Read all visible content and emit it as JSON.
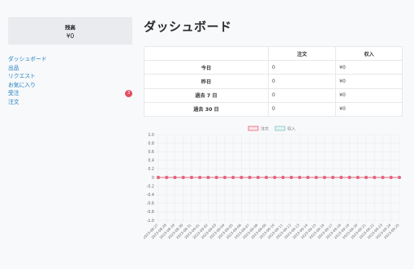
{
  "sidebar": {
    "balance": {
      "label": "残高",
      "value": "¥0"
    },
    "items": [
      {
        "label": "ダッシュボード"
      },
      {
        "label": "出品"
      },
      {
        "label": "リクエスト"
      },
      {
        "label": "お気に入り"
      },
      {
        "label": "受注",
        "badge": "3"
      },
      {
        "label": "注文"
      }
    ]
  },
  "main": {
    "title": "ダッシュボード",
    "table": {
      "headers": [
        "",
        "注文",
        "収入"
      ],
      "rows": [
        {
          "period": "今日",
          "orders": "0",
          "income": "¥0"
        },
        {
          "period": "昨日",
          "orders": "0",
          "income": "¥0"
        },
        {
          "period": "過去 7 日",
          "orders": "0",
          "income": "¥0"
        },
        {
          "period": "過去 30 日",
          "orders": "0",
          "income": "¥0"
        }
      ]
    }
  },
  "chart_data": {
    "type": "line",
    "title": "",
    "xlabel": "",
    "ylabel": "",
    "ylim": [
      -1.0,
      1.0
    ],
    "yticks": [
      "1.0",
      "0.8",
      "0.6",
      "0.4",
      "0.2",
      "0",
      "-0.2",
      "-0.4",
      "-0.6",
      "-0.8",
      "-1.0"
    ],
    "categories": [
      "2023-08-27",
      "2023-08-28",
      "2023-08-29",
      "2023-08-30",
      "2023-08-31",
      "2023-09-01",
      "2023-09-02",
      "2023-09-03",
      "2023-09-04",
      "2023-09-05",
      "2023-09-06",
      "2023-09-07",
      "2023-09-08",
      "2023-09-09",
      "2023-09-10",
      "2023-09-11",
      "2023-09-12",
      "2023-09-13",
      "2023-09-14",
      "2023-09-15",
      "2023-09-16",
      "2023-09-17",
      "2023-09-18",
      "2023-09-19",
      "2023-09-20",
      "2023-09-21",
      "2023-09-22",
      "2023-09-23",
      "2023-09-24",
      "2023-09-25"
    ],
    "series": [
      {
        "name": "注文",
        "color": "#e8627a",
        "fill": "#fbe3e7",
        "values": [
          0,
          0,
          0,
          0,
          0,
          0,
          0,
          0,
          0,
          0,
          0,
          0,
          0,
          0,
          0,
          0,
          0,
          0,
          0,
          0,
          0,
          0,
          0,
          0,
          0,
          0,
          0,
          0,
          0,
          0
        ]
      },
      {
        "name": "収入",
        "color": "#7fc4c7",
        "fill": "#e4f3f3",
        "values": [
          0,
          0,
          0,
          0,
          0,
          0,
          0,
          0,
          0,
          0,
          0,
          0,
          0,
          0,
          0,
          0,
          0,
          0,
          0,
          0,
          0,
          0,
          0,
          0,
          0,
          0,
          0,
          0,
          0,
          0
        ]
      }
    ],
    "legend": "top",
    "grid": true
  }
}
